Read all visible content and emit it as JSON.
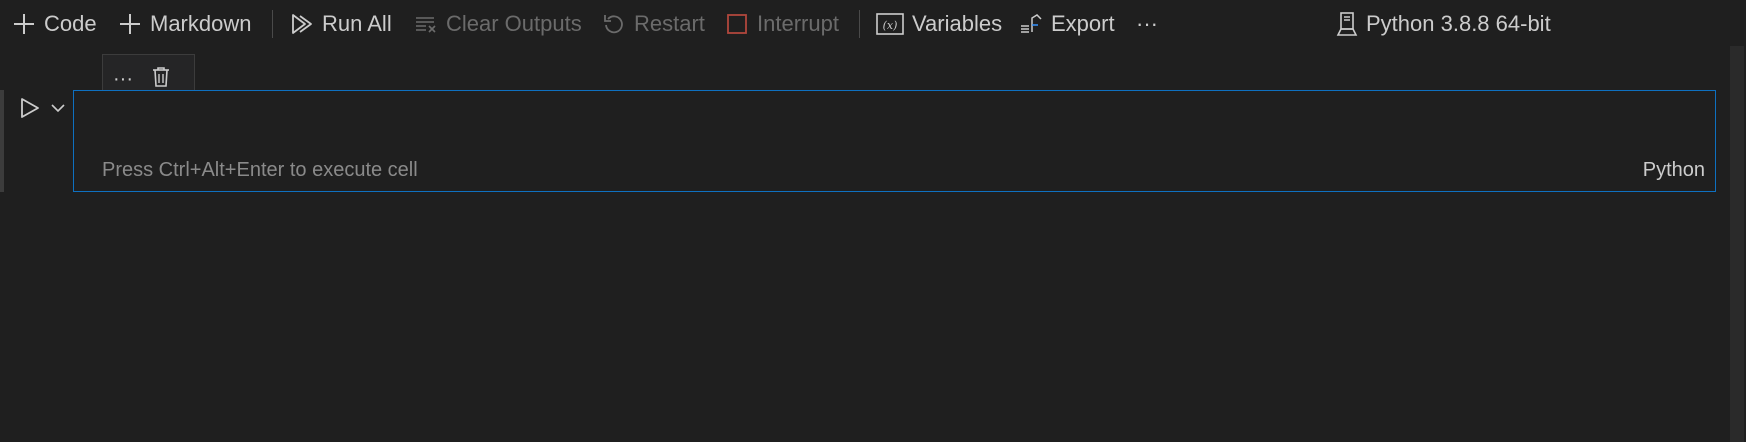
{
  "toolbar": {
    "add_code": "Code",
    "add_markdown": "Markdown",
    "run_all": "Run All",
    "clear_outputs": "Clear Outputs",
    "restart": "Restart",
    "interrupt": "Interrupt",
    "variables": "Variables",
    "export": "Export",
    "more": "···",
    "kernel": "Python 3.8.8 64-bit"
  },
  "cell": {
    "toolbar_more": "···",
    "placeholder": "Press Ctrl+Alt+Enter to execute cell",
    "language": "Python"
  },
  "colors": {
    "background": "#1f1f1f",
    "text": "#cccccc",
    "disabled_text": "#6b6b6b",
    "focus_border": "#0e70c0",
    "interrupt_icon": "#b0473c"
  }
}
